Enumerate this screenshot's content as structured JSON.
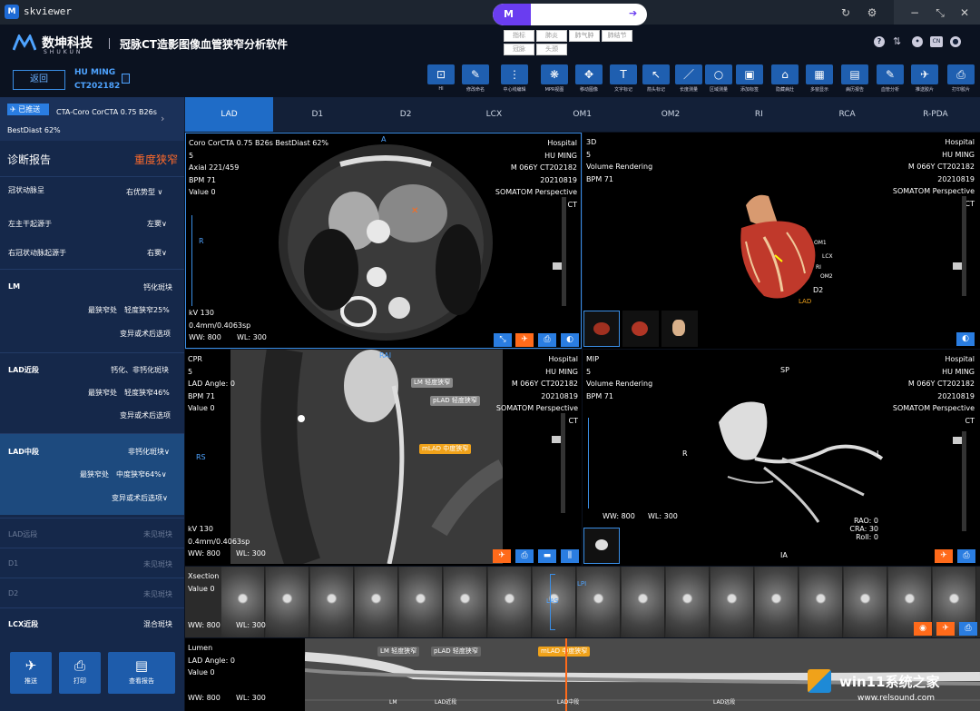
{
  "window": {
    "title": "skviewer"
  },
  "search": {
    "chips": [
      "指标",
      "肺炎",
      "肺气肿",
      "肺结节",
      "冠脉",
      "头颈"
    ]
  },
  "header": {
    "brand": "数坤科技",
    "brand_sub": "SHUKUN",
    "app_name": "冠脉CT造影图像血管狭窄分析软件",
    "back": "返回",
    "patient_name": "HU MING",
    "patient_id": "CT202182",
    "tools": [
      {
        "icon": "hi-icon",
        "label": "HI"
      },
      {
        "icon": "rename-icon",
        "label": "修改命名"
      },
      {
        "icon": "centerline-icon",
        "label": "中心线编辑"
      },
      {
        "icon": "mpr-icon",
        "label": "MPR视图"
      },
      {
        "icon": "move-icon",
        "label": "移动图像"
      },
      {
        "icon": "text-icon",
        "label": "文字标记"
      },
      {
        "icon": "arrow-icon",
        "label": "箭头标记"
      },
      {
        "icon": "measure-icon",
        "label": "长度测量"
      },
      {
        "icon": "circle-icon",
        "label": "区域测量"
      },
      {
        "icon": "save-icon",
        "label": "添加标签"
      },
      {
        "icon": "lesion-icon",
        "label": "隐藏病灶"
      },
      {
        "icon": "multi-icon",
        "label": "多窗显示"
      },
      {
        "icon": "report-icon",
        "label": "病历报告"
      },
      {
        "icon": "edit-icon",
        "label": "血管分析"
      },
      {
        "icon": "send-icon",
        "label": "推送胶片"
      },
      {
        "icon": "print-icon",
        "label": "打印胶片"
      }
    ],
    "right_icons": [
      "help-icon",
      "sort-icon",
      "settings-icon",
      "language-icon",
      "user-icon"
    ],
    "lang": "CN"
  },
  "sidebar": {
    "pushed": "已推送",
    "series": "CTA-Coro CorCTA 0.75 B26s BestDiast 62%",
    "report_title": "诊断报告",
    "severity": "重度狭窄",
    "rows": [
      {
        "label": "冠状动脉呈",
        "value": "右优势型"
      },
      {
        "label": "左主干起源于",
        "value": "左窦"
      },
      {
        "label": "右冠状动脉起源于",
        "value": "右窦"
      }
    ],
    "lm": {
      "label": "LM",
      "l1": "钙化斑块",
      "l2": "最狭窄处　轻度狭窄25%",
      "l3": "变异或术后选项"
    },
    "lad_p": {
      "label": "LAD近段",
      "l1": "钙化、非钙化斑块",
      "l2": "最狭窄处　轻度狭窄46%",
      "l3": "变异或术后选项"
    },
    "lad_m": {
      "label": "LAD中段",
      "l1": "非钙化斑块",
      "l2": "最狭窄处　中度狭窄64%",
      "l3": "变异或术后选项"
    },
    "dim_rows": [
      {
        "label": "LAD远段",
        "value": "未见斑块"
      },
      {
        "label": "D1",
        "value": "未见斑块"
      },
      {
        "label": "D2",
        "value": "未见斑块"
      }
    ],
    "lcx": {
      "label": "LCX近段",
      "value": "混合斑块"
    },
    "buttons": [
      {
        "icon": "send-icon",
        "label": "推送"
      },
      {
        "icon": "print-icon",
        "label": "打印"
      },
      {
        "icon": "report-icon",
        "label": "查看报告"
      }
    ]
  },
  "tabs": [
    "LAD",
    "D1",
    "D2",
    "LCX",
    "OM1",
    "OM2",
    "RI",
    "RCA",
    "R-PDA"
  ],
  "active_tab": "LAD",
  "viewports": {
    "axial": {
      "tl": [
        "Coro CorCTA 0.75 B26s BestDiast 62%",
        "5",
        "Axial 221/459",
        "BPM 71",
        "Value 0"
      ],
      "tr": [
        "Hospital",
        "HU MING",
        "M 066Y CT202182",
        "20210819",
        "SOMATOM Perspective",
        "CT"
      ],
      "bl": [
        "kV 130",
        "0.4mm/0.4063sp"
      ],
      "ww": "WW: 800",
      "wl": "WL: 300",
      "orient_top": "A",
      "orient_left": "R"
    },
    "v3d": {
      "tl": [
        "3D",
        "5",
        "Volume Rendering",
        "BPM 71"
      ],
      "tr": [
        "Hospital",
        "HU MING",
        "M 066Y CT202182",
        "20210819",
        "SOMATOM Perspective",
        "CT"
      ],
      "labels": [
        "OM1",
        "LCX",
        "RI",
        "OM2",
        "D2",
        "LAD"
      ]
    },
    "cpr": {
      "tl": [
        "CPR",
        "5",
        "LAD Angle: 0",
        "BPM 71",
        "Value 0"
      ],
      "tr": [
        "Hospital",
        "HU MING",
        "M 066Y CT202182",
        "20210819",
        "SOMATOM Perspective",
        "CT"
      ],
      "bl": [
        "kV 130",
        "0.4mm/0.4063sp"
      ],
      "ww": "WW: 800",
      "wl": "WL: 300",
      "orient_top": "RAI",
      "orient_left": "RS",
      "tags": [
        "LM 轻度狭窄",
        "pLAD 轻度狭窄",
        "mLAD 中度狭窄"
      ]
    },
    "mip": {
      "tl": [
        "MIP",
        "5",
        "Volume Rendering",
        "BPM 71"
      ],
      "tr": [
        "Hospital",
        "HU MING",
        "M 066Y CT202182",
        "20210819",
        "SOMATOM Perspective",
        "CT"
      ],
      "ww": "WW: 800",
      "wl": "WL: 300",
      "sp": "SP",
      "ia": "IA",
      "r": "R",
      "l": "L",
      "br": [
        "RAO: 0",
        "CRA: 30",
        "Roll: 0"
      ]
    },
    "xsection": {
      "tl": [
        "Xsection",
        "Value 0"
      ],
      "ww": "WW: 800",
      "wl": "WL: 300",
      "lpi": "LPI",
      "las": "LAS"
    },
    "lumen": {
      "tl": [
        "Lumen",
        "LAD Angle: 0",
        "Value 0"
      ],
      "ww": "WW: 800",
      "wl": "WL: 300",
      "tags": [
        "LM 轻度狭窄",
        "pLAD 轻度狭窄",
        "mLAD 中度狭窄"
      ],
      "ruler": [
        "LM",
        "LAD近段",
        "LAD中段",
        "LAD远段"
      ]
    }
  },
  "watermark": {
    "site": "win11系统之家",
    "url": "www.relsound.com"
  }
}
